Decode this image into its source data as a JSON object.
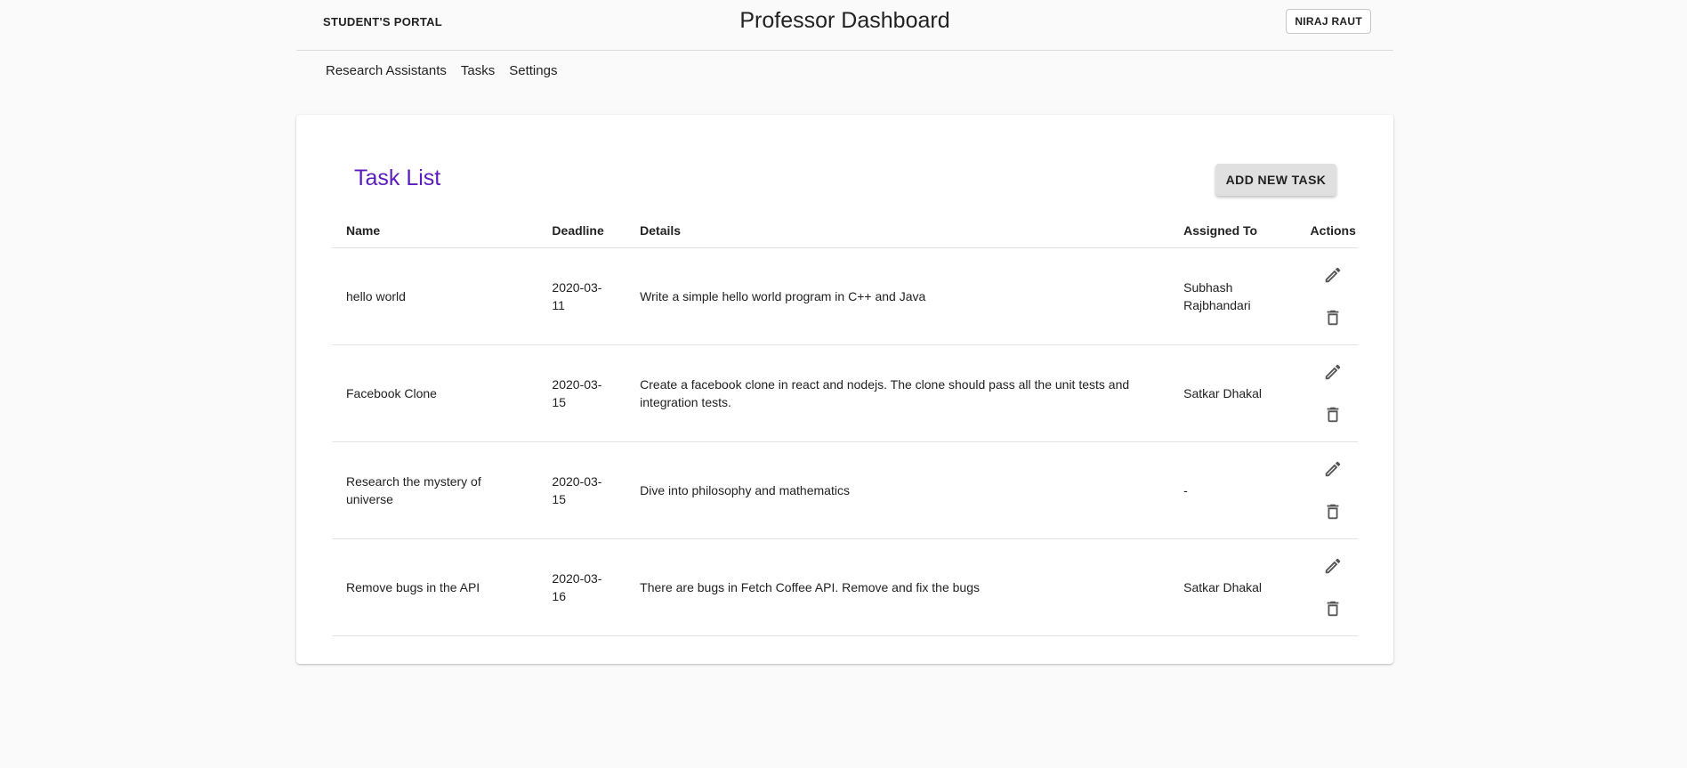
{
  "header": {
    "brand": "STUDENT'S PORTAL",
    "title": "Professor Dashboard",
    "user_button": "NIRAJ RAUT"
  },
  "nav": {
    "items": [
      "Research Assistants",
      "Tasks",
      "Settings"
    ]
  },
  "task_list": {
    "title": "Task List",
    "add_button": "ADD NEW TASK",
    "columns": {
      "name": "Name",
      "deadline": "Deadline",
      "details": "Details",
      "assigned": "Assigned To",
      "actions": "Actions"
    },
    "rows": [
      {
        "name": "hello world",
        "deadline": "2020-03-11",
        "details": "Write a simple hello world program in C++ and Java",
        "assigned": "Subhash Rajbhandari"
      },
      {
        "name": "Facebook Clone",
        "deadline": "2020-03-15",
        "details": "Create a facebook clone in react and nodejs. The clone should pass all the unit tests and integration tests.",
        "assigned": "Satkar Dhakal"
      },
      {
        "name": "Research the mystery of universe",
        "deadline": "2020-03-15",
        "details": "Dive into philosophy and mathematics",
        "assigned": "-"
      },
      {
        "name": "Remove bugs in the API",
        "deadline": "2020-03-16",
        "details": "There are bugs in Fetch Coffee API. Remove and fix the bugs",
        "assigned": "Satkar Dhakal"
      }
    ],
    "row_action_icons": [
      "edit-icon",
      "delete-icon"
    ]
  },
  "colors": {
    "title_accent": "#5b1bbf",
    "background": "#fafafa",
    "button_gray": "#e0e0e0"
  }
}
